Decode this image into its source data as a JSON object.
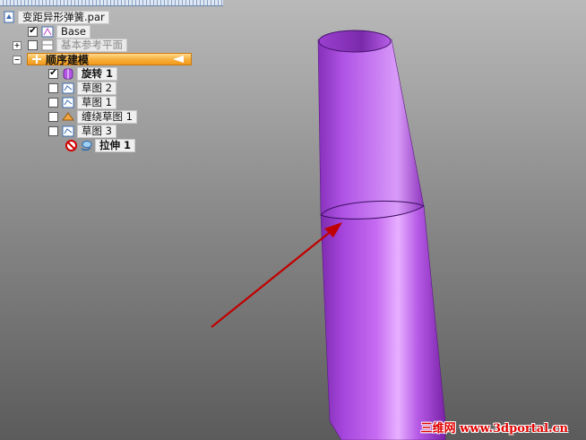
{
  "tree": {
    "root_label": "变距异形弹簧.par",
    "items": [
      {
        "label": "Base",
        "checked": true,
        "icon": "base-icon"
      },
      {
        "label": "基本参考平面",
        "checked": false,
        "icon": "reference-planes-icon"
      },
      {
        "label": "顺序建模",
        "icon": "ordered-modeling-icon"
      },
      {
        "label": "旋转 1",
        "checked": true,
        "icon": "revolve-icon"
      },
      {
        "label": "草图 2",
        "checked": false,
        "icon": "sketch-icon"
      },
      {
        "label": "草图 1",
        "checked": false,
        "icon": "sketch-icon"
      },
      {
        "label": "缠绕草图 1",
        "checked": false,
        "icon": "wrap-sketch-icon"
      },
      {
        "label": "草图 3",
        "checked": false,
        "icon": "sketch-icon"
      },
      {
        "label": "拉伸 1",
        "icon": "extrude-icon",
        "status_icon": "error-icon"
      }
    ],
    "expanders": {
      "reference_planes": "+",
      "ordered_modeling": "−"
    }
  },
  "watermark": {
    "text": "三维网 www.3dportal.cn"
  },
  "colors": {
    "accent_orange": "#f39a1c",
    "model_purple": "#b455e6",
    "arrow_red": "#c00000",
    "watermark_red": "#e00000"
  }
}
